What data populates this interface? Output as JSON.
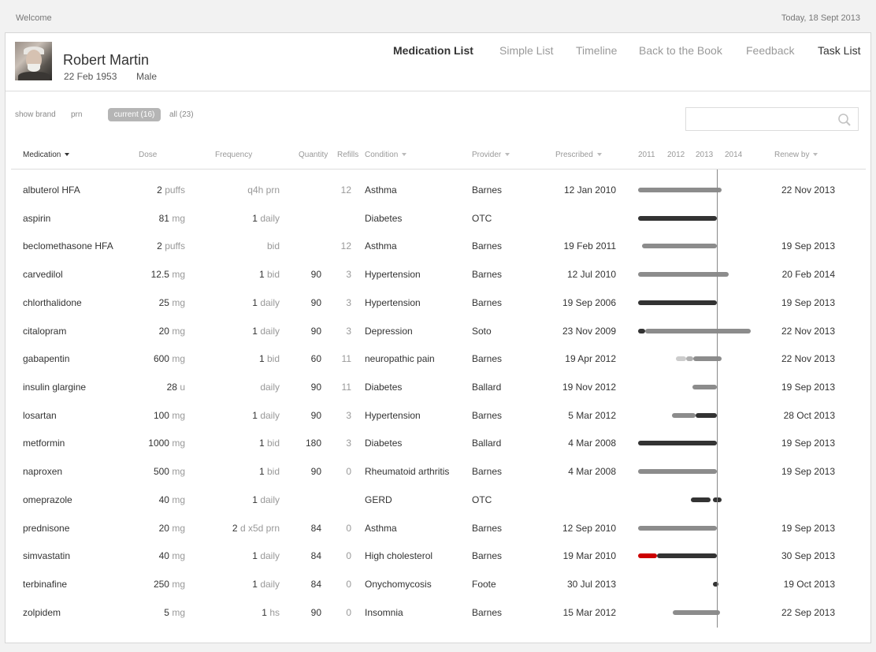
{
  "topbar": {
    "welcome": "Welcome",
    "date": "Today, 18 Sept 2013"
  },
  "patient": {
    "name": "Robert Martin",
    "dob": "22 Feb 1953",
    "sex": "Male"
  },
  "nav": [
    {
      "label": "Medication List",
      "active": true
    },
    {
      "label": "Simple List"
    },
    {
      "label": "Timeline"
    },
    {
      "label": "Back to the Book"
    },
    {
      "label": "Feedback"
    },
    {
      "label": "Task List"
    }
  ],
  "filters": {
    "show_brand": "show brand",
    "prn": "prn",
    "current": "current (16)",
    "all": "all (23)"
  },
  "search": {
    "placeholder": ""
  },
  "columns": {
    "medication": "Medication",
    "dose": "Dose",
    "frequency": "Frequency",
    "quantity": "Quantity",
    "refills": "Refills",
    "condition": "Condition",
    "provider": "Provider",
    "prescribed": "Prescribed",
    "years": [
      "2011",
      "2012",
      "2013",
      "2014"
    ],
    "renew_by": "Renew by"
  },
  "colors": {
    "bar_dark": "#333333",
    "bar_mid": "#8c8c8c",
    "bar_light": "#cccccc",
    "alert": "#cc0000"
  },
  "medications": [
    {
      "name": "albuterol HFA",
      "dose": "2",
      "unit": "puffs",
      "freq_num": "",
      "freq": "q4h prn",
      "quantity": "",
      "refills": "12",
      "condition": "Asthma",
      "provider": "Barnes",
      "prescribed": "12 Jan  2010",
      "renew_by": "22 Nov 2013",
      "timeline": [
        {
          "from": "2011-01-01",
          "to": "2013-11-22",
          "shade": "mid"
        }
      ]
    },
    {
      "name": "aspirin",
      "dose": "81",
      "unit": "mg",
      "freq_num": "1",
      "freq": "daily",
      "quantity": "",
      "refills": "",
      "condition": "Diabetes",
      "provider": "OTC",
      "prescribed": "",
      "renew_by": "",
      "timeline": [
        {
          "from": "2011-01-01",
          "to": "2013-09-18",
          "shade": "dark"
        }
      ]
    },
    {
      "name": "beclomethasone HFA",
      "dose": "2",
      "unit": "puffs",
      "freq_num": "",
      "freq": "bid",
      "quantity": "",
      "refills": "12",
      "condition": "Asthma",
      "provider": "Barnes",
      "prescribed": "19 Feb 2011",
      "renew_by": "19 Sep 2013",
      "timeline": [
        {
          "from": "2011-02-19",
          "to": "2013-09-18",
          "shade": "mid"
        }
      ]
    },
    {
      "name": "carvedilol",
      "dose": "12.5",
      "unit": "mg",
      "freq_num": "1",
      "freq": "bid",
      "quantity": "90",
      "refills": "3",
      "condition": "Hypertension",
      "provider": "Barnes",
      "prescribed": "12  Jul  2010",
      "renew_by": "20 Feb 2014",
      "timeline": [
        {
          "from": "2011-01-01",
          "to": "2014-02-20",
          "shade": "mid"
        }
      ]
    },
    {
      "name": "chlorthalidone",
      "dose": "25",
      "unit": "mg",
      "freq_num": "1",
      "freq": "daily",
      "quantity": "90",
      "refills": "3",
      "condition": "Hypertension",
      "provider": "Barnes",
      "prescribed": "19 Sep 2006",
      "renew_by": "19 Sep 2013",
      "timeline": [
        {
          "from": "2011-01-01",
          "to": "2013-09-18",
          "shade": "dark"
        }
      ]
    },
    {
      "name": "citalopram",
      "dose": "20",
      "unit": "mg",
      "freq_num": "1",
      "freq": "daily",
      "quantity": "90",
      "refills": "3",
      "condition": "Depression",
      "provider": "Soto",
      "prescribed": "23 Nov 2009",
      "renew_by": "22 Nov 2013",
      "timeline": [
        {
          "from": "2011-01-01",
          "to": "2011-04-01",
          "shade": "dark"
        },
        {
          "from": "2011-04-01",
          "to": "2014-11-22",
          "shade": "mid"
        }
      ]
    },
    {
      "name": "gabapentin",
      "dose": "600",
      "unit": "mg",
      "freq_num": "1",
      "freq": "bid",
      "quantity": "60",
      "refills": "11",
      "condition": "neuropathic pain",
      "provider": "Barnes",
      "prescribed": "19  Apr  2012",
      "renew_by": "22 Nov 2013",
      "timeline": [
        {
          "from": "2012-04-19",
          "to": "2012-09-01",
          "shade": "light"
        },
        {
          "from": "2012-09-01",
          "to": "2012-12-01",
          "shade": "lighter"
        },
        {
          "from": "2012-12-01",
          "to": "2013-11-22",
          "shade": "mid"
        }
      ]
    },
    {
      "name": "insulin glargine",
      "dose": "28",
      "unit": "u",
      "freq_num": "",
      "freq": "daily",
      "quantity": "90",
      "refills": "11",
      "condition": "Diabetes",
      "provider": "Ballard",
      "prescribed": "19 Nov 2012",
      "renew_by": "19 Sep 2013",
      "timeline": [
        {
          "from": "2012-11-19",
          "to": "2013-09-18",
          "shade": "mid"
        }
      ]
    },
    {
      "name": "losartan",
      "dose": "100",
      "unit": "mg",
      "freq_num": "1",
      "freq": "daily",
      "quantity": "90",
      "refills": "3",
      "condition": "Hypertension",
      "provider": "Barnes",
      "prescribed": "5  Mar  2012",
      "renew_by": "28  Oct 2013",
      "timeline": [
        {
          "from": "2012-03-05",
          "to": "2013-01-01",
          "shade": "mid"
        },
        {
          "from": "2013-01-01",
          "to": "2013-09-18",
          "shade": "dark"
        }
      ]
    },
    {
      "name": "metformin",
      "dose": "1000",
      "unit": "mg",
      "freq_num": "1",
      "freq": "bid",
      "quantity": "180",
      "refills": "3",
      "condition": "Diabetes",
      "provider": "Ballard",
      "prescribed": "4  Mar  2008",
      "renew_by": "19 Sep 2013",
      "timeline": [
        {
          "from": "2011-01-01",
          "to": "2013-09-18",
          "shade": "dark"
        }
      ]
    },
    {
      "name": "naproxen",
      "dose": "500",
      "unit": "mg",
      "freq_num": "1",
      "freq": "bid",
      "quantity": "90",
      "refills": "0",
      "condition": "Rheumatoid arthritis",
      "provider": "Barnes",
      "prescribed": "4  Mar  2008",
      "renew_by": "19 Sep 2013",
      "timeline": [
        {
          "from": "2011-01-01",
          "to": "2013-09-18",
          "shade": "mid"
        }
      ]
    },
    {
      "name": "omeprazole",
      "dose": "40",
      "unit": "mg",
      "freq_num": "1",
      "freq": "daily",
      "quantity": "",
      "refills": "",
      "condition": "GERD",
      "provider": "OTC",
      "prescribed": "",
      "renew_by": "",
      "timeline": [
        {
          "from": "2012-11-01",
          "to": "2013-07-01",
          "shade": "dark"
        },
        {
          "from": "2013-08-01",
          "to": "2013-11-22",
          "shade": "dark"
        }
      ]
    },
    {
      "name": "prednisone",
      "dose": "20",
      "unit": "mg",
      "freq_num": "2",
      "freq": "d x5d prn",
      "quantity": "84",
      "refills": "0",
      "condition": "Asthma",
      "provider": "Barnes",
      "prescribed": "12 Sep 2010",
      "renew_by": "19 Sep 2013",
      "timeline": [
        {
          "from": "2011-01-01",
          "to": "2013-09-18",
          "shade": "mid"
        }
      ]
    },
    {
      "name": "simvastatin",
      "dose": "40",
      "unit": "mg",
      "freq_num": "1",
      "freq": "daily",
      "quantity": "84",
      "refills": "0",
      "condition": "High cholesterol",
      "provider": "Barnes",
      "prescribed": "19 Mar 2010",
      "renew_by": "30 Sep 2013",
      "timeline": [
        {
          "from": "2011-01-01",
          "to": "2011-09-01",
          "shade": "alert"
        },
        {
          "from": "2011-09-01",
          "to": "2013-09-18",
          "shade": "dark"
        }
      ]
    },
    {
      "name": "terbinafine",
      "dose": "250",
      "unit": "mg",
      "freq_num": "1",
      "freq": "daily",
      "quantity": "84",
      "refills": "0",
      "condition": "Onychomycosis",
      "provider": "Foote",
      "prescribed": "30  Jul  2013",
      "renew_by": "19  Oct 2013",
      "timeline": [
        {
          "from": "2013-08-15",
          "to": "2013-10-01",
          "shade": "dark"
        }
      ]
    },
    {
      "name": "zolpidem",
      "dose": "5",
      "unit": "mg",
      "freq_num": "1",
      "freq": "hs",
      "quantity": "90",
      "refills": "0",
      "condition": "Insomnia",
      "provider": "Barnes",
      "prescribed": "15 Mar 2012",
      "renew_by": "22 Sep 2013",
      "timeline": [
        {
          "from": "2012-03-15",
          "to": "2013-11-01",
          "shade": "mid"
        }
      ]
    }
  ]
}
